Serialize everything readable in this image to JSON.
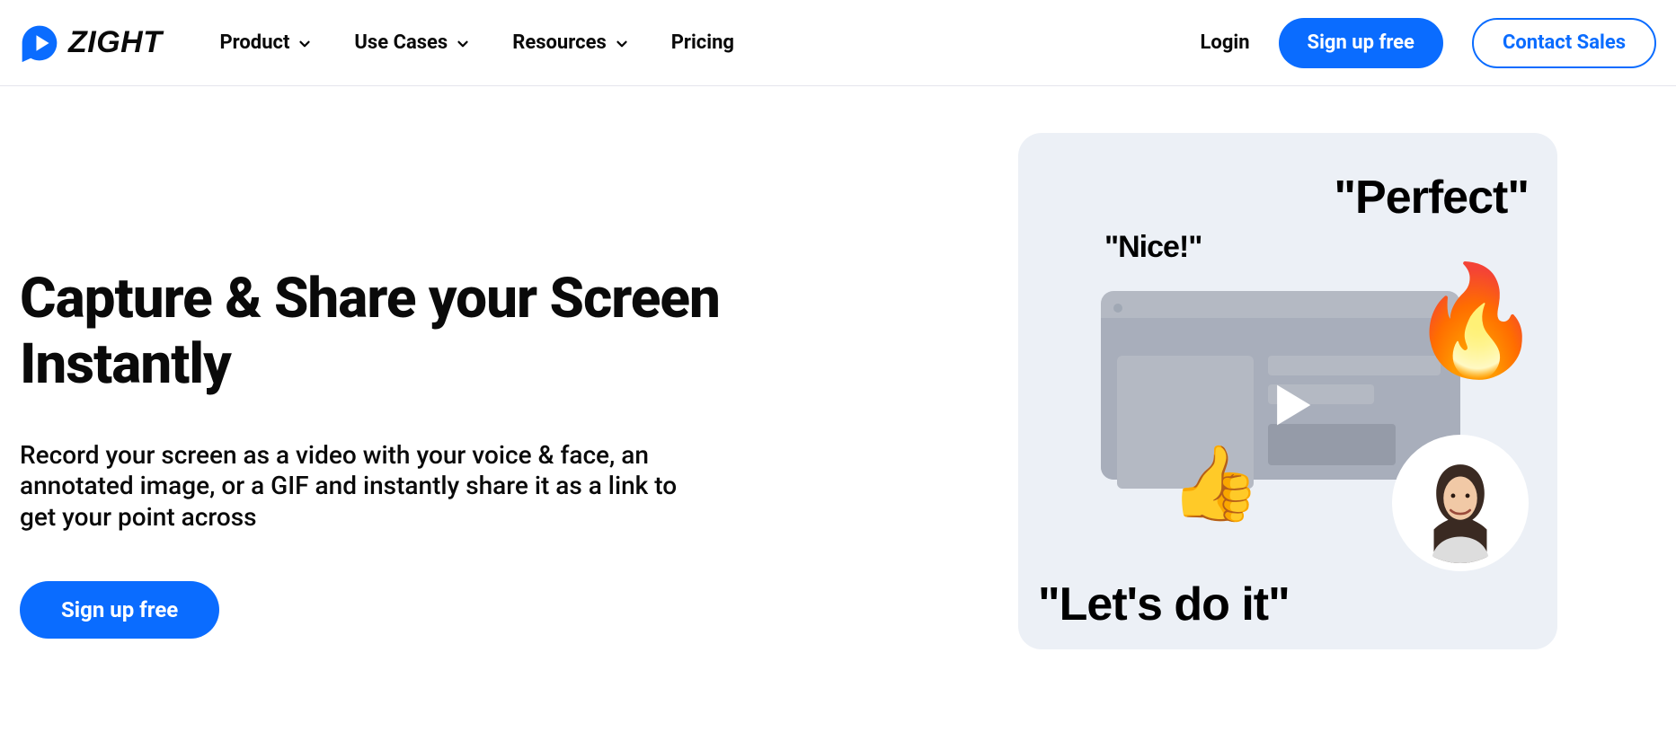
{
  "brand": {
    "name": "ZIGHT"
  },
  "nav": {
    "items": [
      {
        "label": "Product",
        "has_chevron": true
      },
      {
        "label": "Use Cases",
        "has_chevron": true
      },
      {
        "label": "Resources",
        "has_chevron": true
      },
      {
        "label": "Pricing",
        "has_chevron": false
      }
    ]
  },
  "header_actions": {
    "login": "Login",
    "signup": "Sign up free",
    "contact": "Contact Sales"
  },
  "hero": {
    "title": "Capture & Share your Screen Instantly",
    "subtitle": "Record your screen as a video with your voice & face, an annotated image, or a GIF and instantly share it as a link to get your point across",
    "cta": "Sign up free"
  },
  "illustration": {
    "reactions": {
      "nice": "\"Nice!\"",
      "perfect": "\"Perfect\"",
      "lets_do_it": "\"Let's do it\""
    },
    "emojis": {
      "fire": "🔥",
      "thumbs_up": "👍"
    }
  },
  "colors": {
    "accent": "#0a6cff",
    "illus_bg": "#ecf0f6"
  }
}
